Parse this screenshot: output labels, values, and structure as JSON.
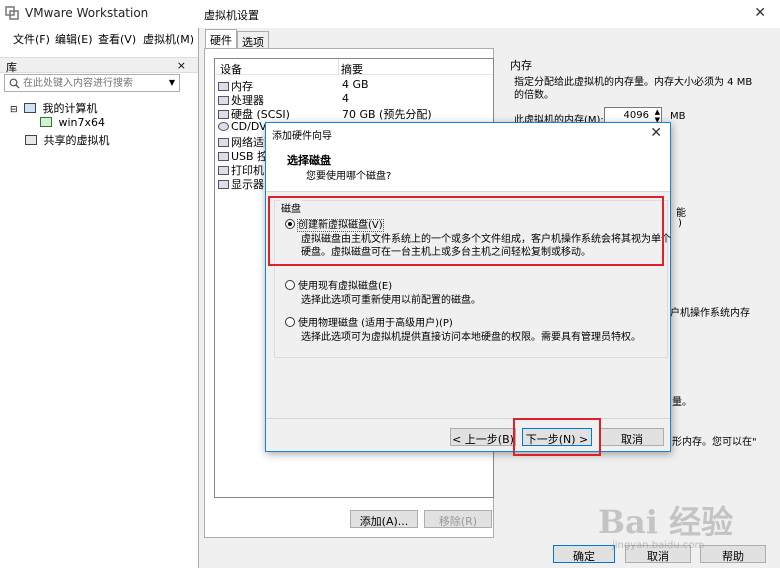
{
  "vmware": {
    "title": "VMware Workstation",
    "menu": [
      "文件(F)",
      "编辑(E)",
      "查看(V)",
      "虚拟机(M)"
    ],
    "library_label": "库",
    "library_close": "×",
    "search_placeholder": "在此处键入内容进行搜索",
    "tree": [
      "我的计算机",
      "win7x64",
      "共享的虚拟机"
    ]
  },
  "settings": {
    "title": "虚拟机设置",
    "close": "✕",
    "tabs": [
      "硬件",
      "选项"
    ],
    "col_device": "设备",
    "col_summary": "摘要",
    "devices": [
      {
        "name": "内存",
        "summary": "4 GB"
      },
      {
        "name": "处理器",
        "summary": "4"
      },
      {
        "name": "硬盘 (SCSI)",
        "summary": "70 GB (预先分配)"
      },
      {
        "name": "CD/DVD",
        "summary": ""
      },
      {
        "name": "网络适配",
        "summary": ""
      },
      {
        "name": "USB 控",
        "summary": ""
      },
      {
        "name": "打印机",
        "summary": ""
      },
      {
        "name": "显示器",
        "summary": ""
      }
    ],
    "memory_group": "内存",
    "memory_desc_1": "指定分配给此虚拟机的内存量。内存大小必须为 4 MB",
    "memory_desc_2": "的倍数。",
    "memory_label": "此虚拟机的内存(M):",
    "memory_value": "4096",
    "memory_unit": "MB",
    "frag_neng": "能",
    "frag_paren": ")",
    "frag_os_mem": "户机操作系统内存",
    "frag_liang": "量。",
    "frag_mem_ok": "形内存。您可以在\"",
    "add_button": "添加(A)...",
    "remove_button": "移除(R)",
    "ok_button": "确定",
    "cancel_button": "取消",
    "help_button": "帮助"
  },
  "wizard": {
    "title": "添加硬件向导",
    "close": "✕",
    "heading": "选择磁盘",
    "subheading": "您要使用哪个磁盘?",
    "group_label": "磁盘",
    "options": [
      {
        "label": "创建新虚拟磁盘(V)",
        "desc_1": "虚拟磁盘由主机文件系统上的一个或多个文件组成，客户机操作系统会将其视为单个",
        "desc_2": "硬盘。虚拟磁盘可在一台主机上或多台主机之间轻松复制或移动。",
        "selected": true
      },
      {
        "label": "使用现有虚拟磁盘(E)",
        "desc_1": "选择此选项可重新使用以前配置的磁盘。",
        "desc_2": "",
        "selected": false
      },
      {
        "label": "使用物理磁盘 (适用于高级用户)(P)",
        "desc_1": "选择此选项可为虚拟机提供直接访问本地硬盘的权限。需要具有管理员特权。",
        "desc_2": "",
        "selected": false
      }
    ],
    "back_button": "< 上一步(B)",
    "next_button": "下一步(N) >",
    "cancel_button": "取消"
  },
  "watermark": {
    "text": "Bai 经验",
    "sub": "jingyan.baidu.com"
  },
  "colors": {
    "highlight": "#e0202a",
    "accent": "#0078d7"
  }
}
